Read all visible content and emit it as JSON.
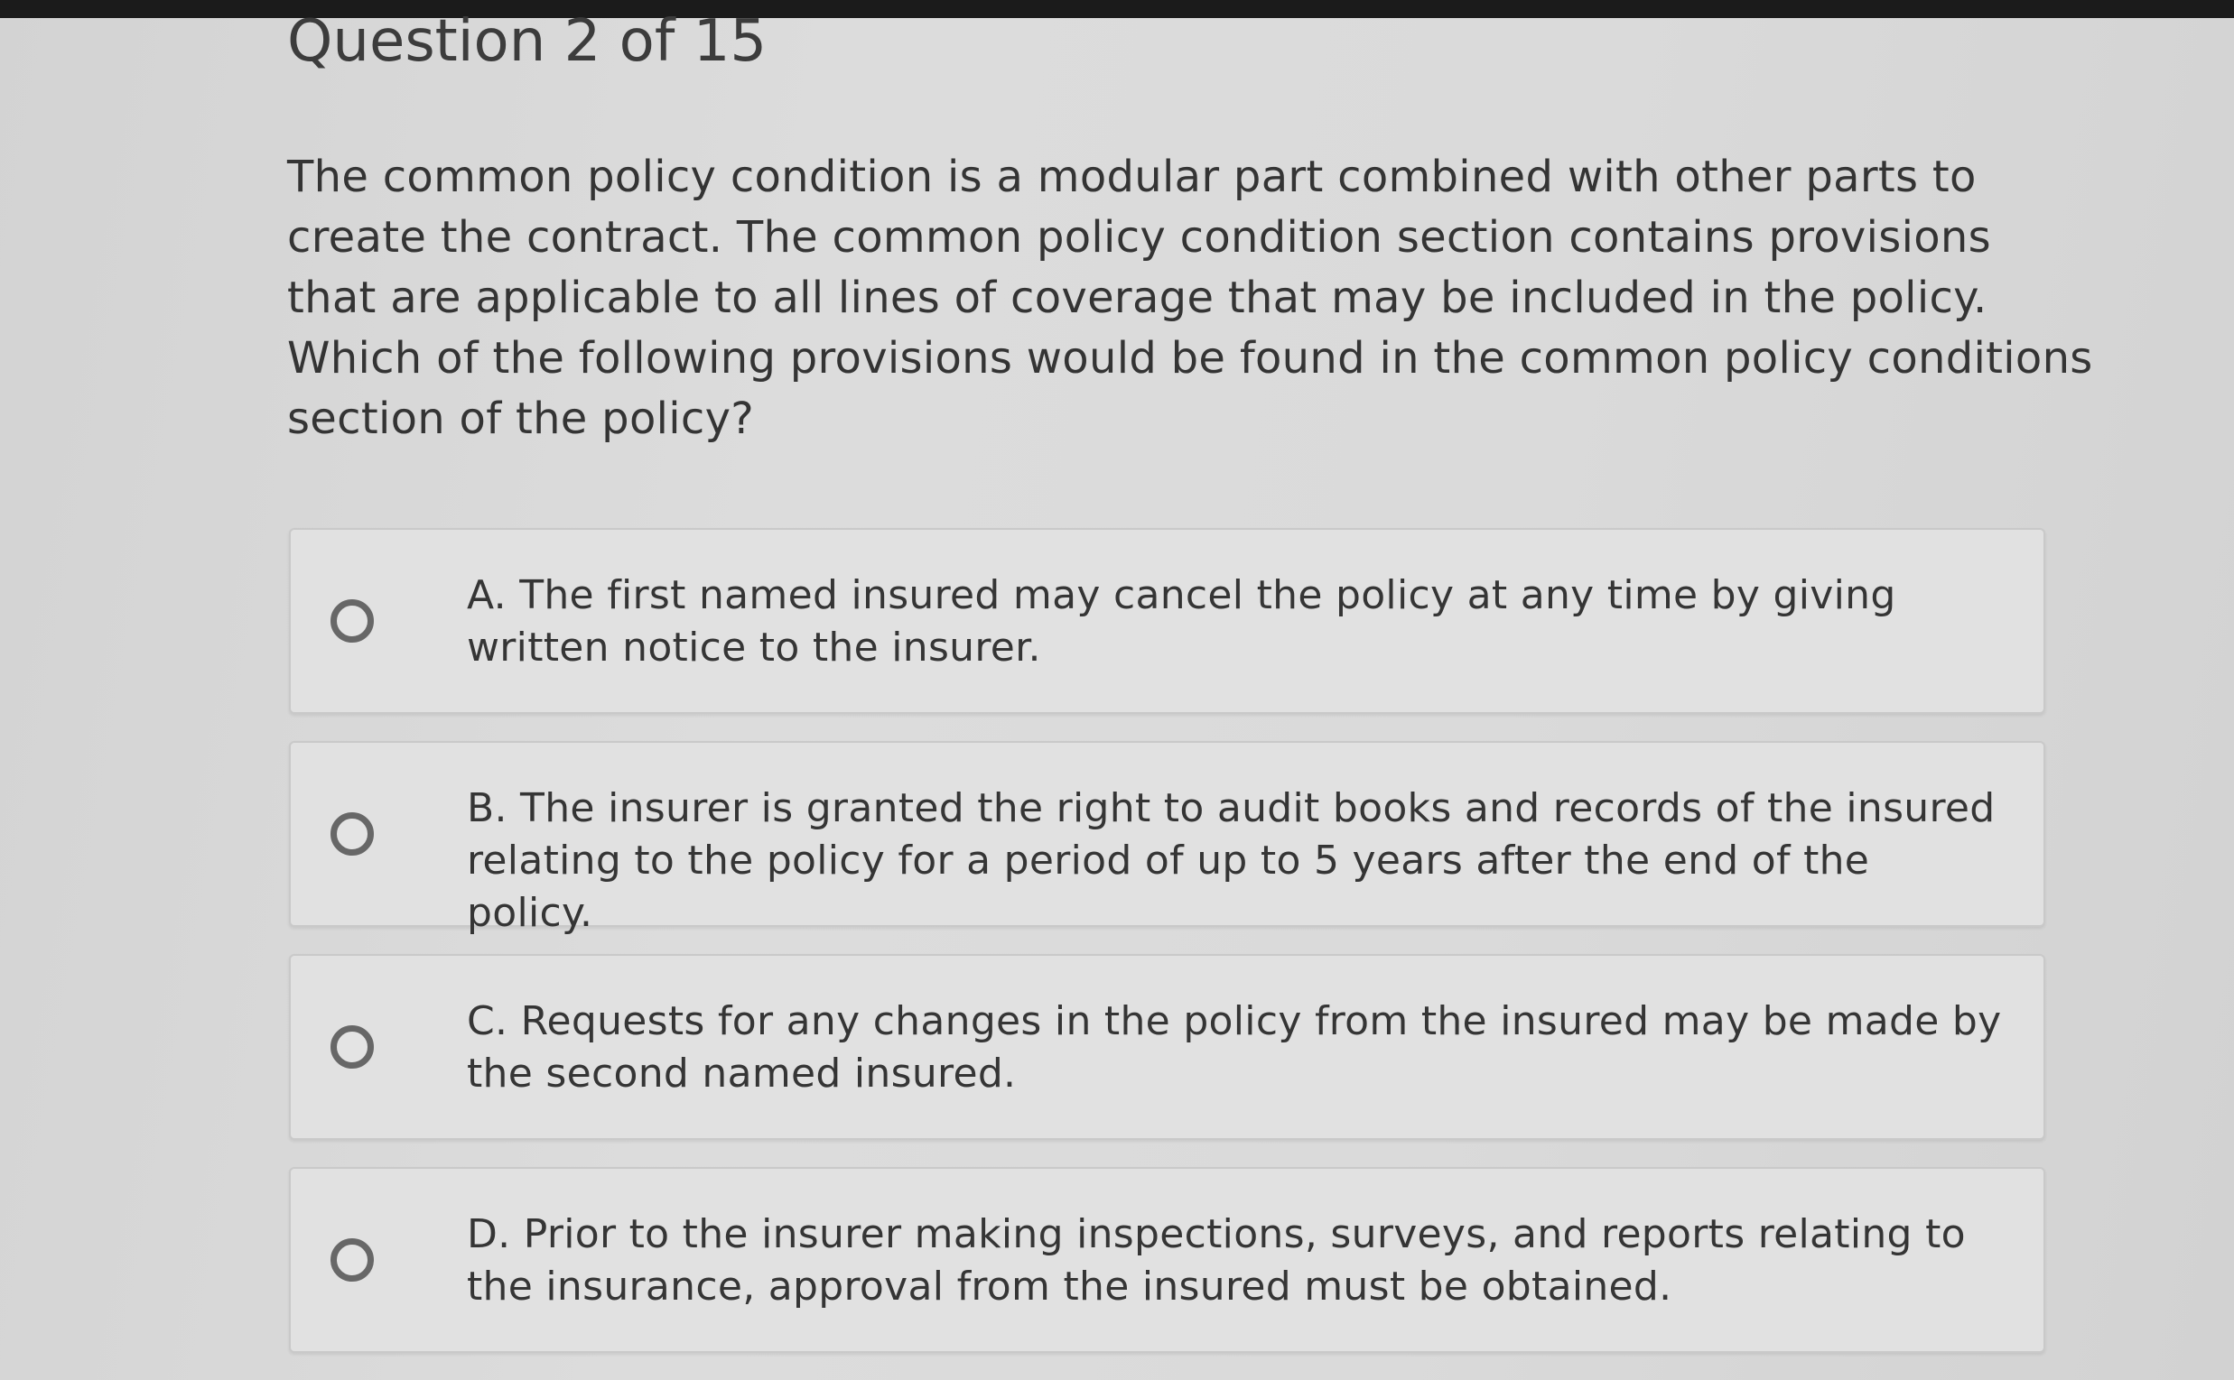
{
  "quiz": {
    "header": "Question 2 of 15",
    "question": "The common policy condition is a modular part combined with other parts to create the contract. The common policy condition section contains provisions that are applicable to all lines of coverage that may be included in the policy. Which of the following provisions would be found in the common policy conditions section of the policy?",
    "options": [
      {
        "text": "A. The first named insured may cancel the policy at any time by giving written notice to the insurer.",
        "selected": false
      },
      {
        "text": "B. The insurer is granted the right to audit books and records of the insured relating to the policy for a period of up to 5 years after the end of the policy.",
        "selected": false
      },
      {
        "text": "C. Requests for any changes in the policy from the insured may be made by the second named insured.",
        "selected": false
      },
      {
        "text": "D. Prior to the insurer making inspections, surveys, and reports relating to the insurance, approval from the insured must be obtained.",
        "selected": false
      }
    ]
  },
  "icons": {
    "radio": "radio-unchecked-icon"
  },
  "colors": {
    "background": "#d9d9d9",
    "top_bar": "#1b1b1b",
    "option_background": "#e1e1e1",
    "option_border": "#c9c9c9",
    "radio_ring": "#676767",
    "text": "#353535"
  }
}
